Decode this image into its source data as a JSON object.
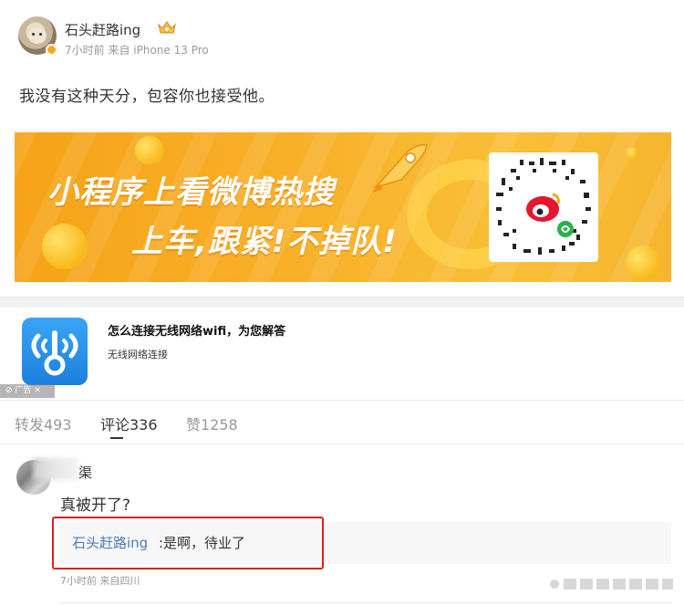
{
  "post": {
    "username": "石头赶路ing",
    "meta": "7小时前 来自 iPhone 13 Pro",
    "text": "我没有这种天分，包容你也接受他。"
  },
  "banner": {
    "line1": "小程序上看微博热搜",
    "line2": "上车,跟紧!不掉队!"
  },
  "ad": {
    "title": "怎么连接无线网络wifi，为您解答",
    "subtitle": "无线网络连接",
    "tag": "广告"
  },
  "tabs": [
    {
      "label": "转发493"
    },
    {
      "label": "评论336"
    },
    {
      "label": "赞1258"
    }
  ],
  "comment": {
    "name": "渠",
    "text": "真被开了?",
    "reply_user": "石头赶路ing",
    "reply_text": ":是啊，待业了",
    "meta": "7小时前 来自四川"
  },
  "colors": {
    "link": "#4d7cb0",
    "banner_orange": "#f7a91f",
    "highlight_red": "#e0201a"
  }
}
